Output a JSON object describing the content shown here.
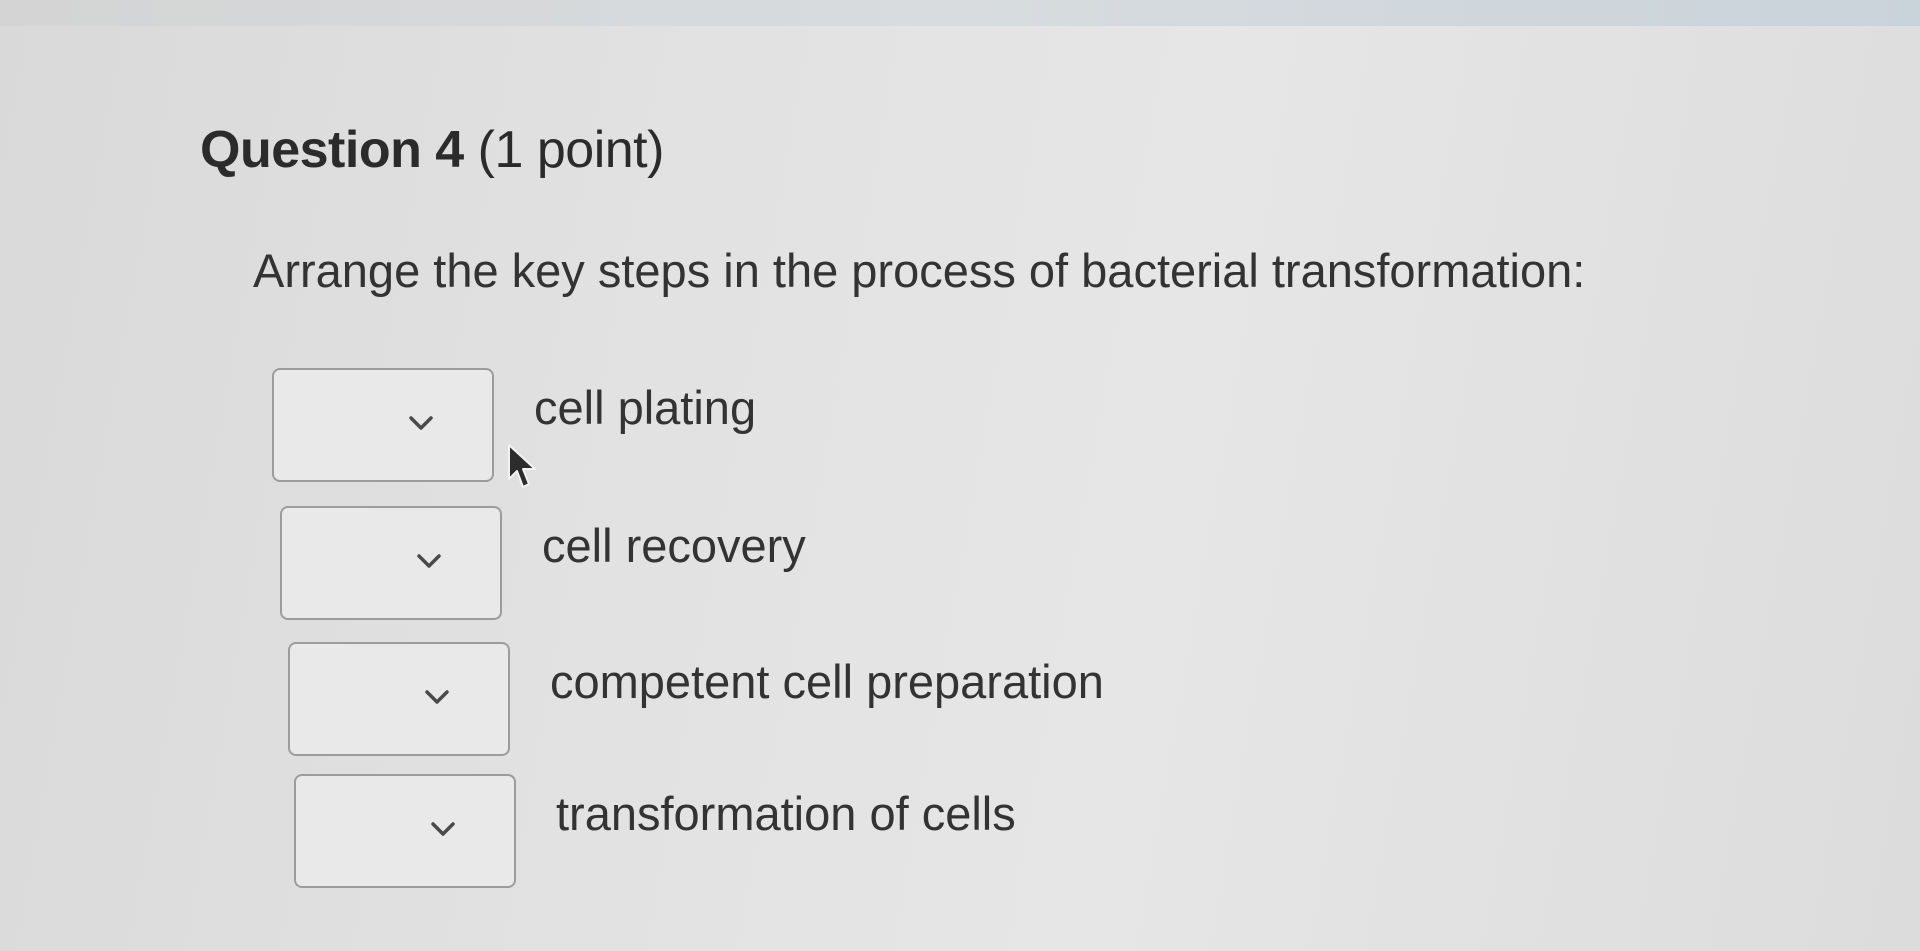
{
  "question": {
    "title": "Question 4",
    "points": "(1 point)",
    "prompt": "Arrange the key steps in the process of bacterial transformation:"
  },
  "steps": [
    {
      "selected": "",
      "label": "cell plating",
      "icon": "chevron-down-icon"
    },
    {
      "selected": "",
      "label": "cell recovery",
      "icon": "chevron-down-icon"
    },
    {
      "selected": "",
      "label": "competent cell preparation",
      "icon": "chevron-down-icon"
    },
    {
      "selected": "",
      "label": "transformation of cells",
      "icon": "chevron-down-icon"
    }
  ],
  "colors": {
    "background": "#e2e2e2",
    "text": "#2f2f2f",
    "select_border": "#9c9c9c",
    "chevron": "#4a4a4a"
  }
}
